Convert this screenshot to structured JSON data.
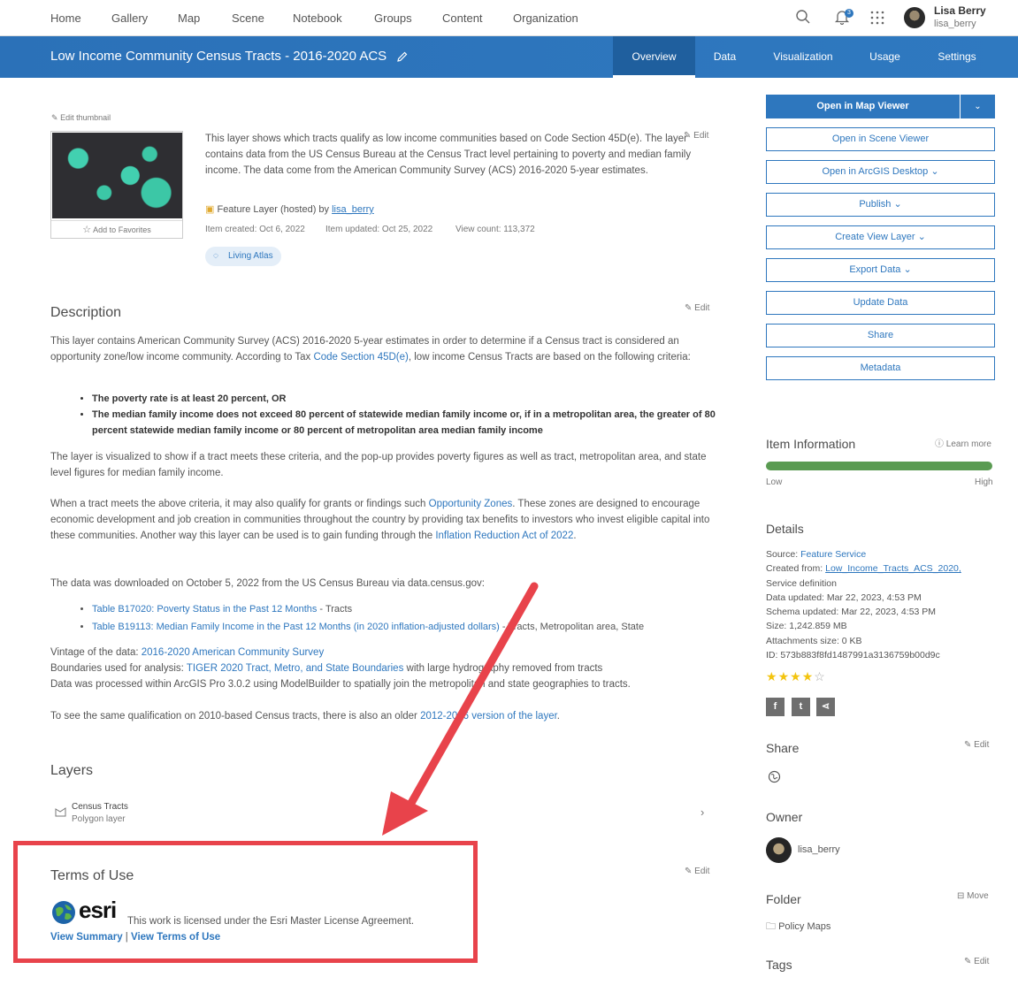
{
  "nav": {
    "items": [
      "Home",
      "Gallery",
      "Map",
      "Scene",
      "Notebook",
      "Groups",
      "Content",
      "Organization"
    ],
    "notification_count": "3",
    "user_name": "Lisa Berry",
    "user_handle": "lisa_berry"
  },
  "titlebar": {
    "title": "Low Income Community Census Tracts - 2016-2020 ACS",
    "tabs": [
      "Overview",
      "Data",
      "Visualization",
      "Usage",
      "Settings"
    ],
    "active_tab": "Overview"
  },
  "overview": {
    "edit_thumbnail": "Edit thumbnail",
    "add_favorites": "Add to Favorites",
    "edit_label": "Edit",
    "summary": "This layer shows which tracts qualify as low income communities based on Code Section 45D(e). The layer contains data from the US Census Bureau at the Census Tract level pertaining to poverty and median family income. The data come from the American Community Survey (ACS) 2016-2020 5-year estimates.",
    "layer_type_prefix": "Feature Layer (hosted) by ",
    "owner": "lisa_berry",
    "created": "Item created: Oct 6, 2022",
    "updated": "Item updated: Oct 25, 2022",
    "views": "View count: 113,372",
    "badge": "Living Atlas"
  },
  "description": {
    "heading": "Description",
    "p1_a": "This layer contains American Community Survey (ACS) 2016-2020 5-year estimates in order to determine if a Census tract is considered an opportunity zone/low income community. According to Tax ",
    "p1_link": "Code Section 45D(e)",
    "p1_b": ", low income Census Tracts are based on the following criteria:",
    "bullet1": "The poverty rate is at least 20 percent, OR",
    "bullet2": "The median family income does not exceed 80 percent of statewide median family income or, if in a metropolitan area, the greater of 80 percent statewide median family income or 80 percent of metropolitan area median family income",
    "p2": "The layer is visualized to show if a tract meets these criteria, and the pop-up provides poverty figures as well as tract, metropolitan area, and state level figures for median family income.",
    "p3_a": "When a tract meets the above criteria, it may also qualify for grants or findings such ",
    "p3_link1": "Opportunity Zones",
    "p3_b": ". These zones are designed to encourage economic development and job creation in communities throughout the country by providing tax benefits to investors who invest eligible capital into these communities. Another way this layer can be used is to gain funding through the ",
    "p3_link2": "Inflation Reduction Act of 2022",
    "p3_c": ".",
    "p4": "The data was downloaded on October 5, 2022 from the US Census Bureau via data.census.gov:",
    "table1_link": "Table B17020: Poverty Status in the Past 12 Months",
    "table1_rest": " - Tracts",
    "table2_link": "Table B19113: Median Family Income in the Past 12 Months (in 2020 inflation-adjusted dollars)",
    "table2_rest": " - Tracts, Metropolitan area, State",
    "vintage_a": "Vintage of the data: ",
    "vintage_link": "2016-2020 American Community Survey",
    "boundaries_a": "Boundaries used for analysis: ",
    "boundaries_link": "TIGER 2020 Tract, Metro, and State Boundaries",
    "boundaries_b": " with large hydrography removed from tracts",
    "processed": "Data was processed within ArcGIS Pro 3.0.2 using ModelBuilder to spatially join the metropolitan and state geographies to tracts.",
    "older_a": "To see the same qualification on 2010-based Census tracts, there is also an older ",
    "older_link": "2012-2016 version of the layer",
    "older_b": "."
  },
  "layers": {
    "heading": "Layers",
    "name": "Census Tracts",
    "type": "Polygon layer"
  },
  "terms": {
    "heading": "Terms of Use",
    "logo_text": "esri",
    "text": "This work is licensed under the Esri Master License Agreement.",
    "link1": "View Summary",
    "separator": " | ",
    "link2": "View Terms of Use"
  },
  "sidebar": {
    "open_map_viewer": "Open in Map Viewer",
    "buttons": [
      "Open in Scene Viewer",
      "Open in ArcGIS Desktop",
      "Publish",
      "Create View Layer",
      "Export Data",
      "Update Data",
      "Share",
      "Metadata"
    ],
    "item_info_heading": "Item Information",
    "learn_more": "Learn more",
    "low": "Low",
    "high": "High",
    "item_info_level": 1.0,
    "details_heading": "Details",
    "source_label": "Source: ",
    "source_value": "Feature Service",
    "created_from_label": "Created from: ",
    "created_from_value": "Low_Income_Tracts_ACS_2020,",
    "service_definition": "Service definition",
    "data_updated": "Data updated: Mar 22, 2023, 4:53 PM",
    "schema_updated": "Schema updated: Mar 22, 2023, 4:53 PM",
    "size": "Size: 1,242.859 MB",
    "attachments": "Attachments size: 0 KB",
    "id": "ID: 573b883f8fd1487991a3136759b00d9c",
    "rating": 4,
    "rating_max": 5,
    "share_heading": "Share",
    "owner_heading": "Owner",
    "owner_name": "lisa_berry",
    "folder_heading": "Folder",
    "move_label": "Move",
    "folder_name": "Policy Maps",
    "tags_heading": "Tags",
    "edit_label": "Edit"
  },
  "colors": {
    "accent": "#2e77be",
    "annotation_red": "#e8434b",
    "bar_green": "#5a9b52"
  }
}
